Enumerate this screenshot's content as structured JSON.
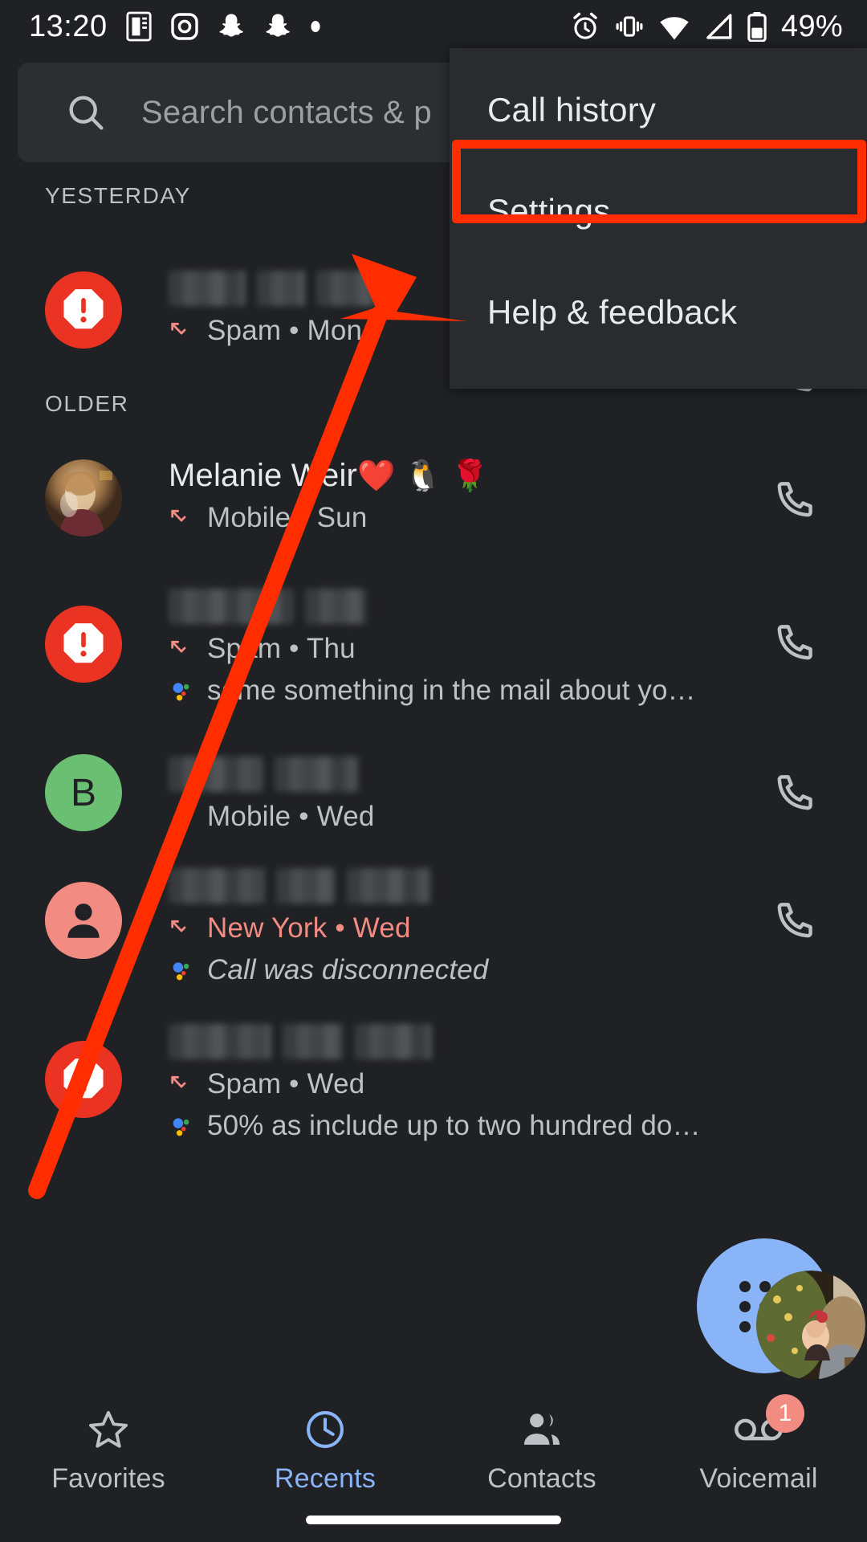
{
  "statusbar": {
    "clock": "13:20",
    "left_icons": [
      "news-icon",
      "instagram-icon",
      "snapchat-icon",
      "snapchat-icon",
      "dot-icon"
    ],
    "right_icons": [
      "alarm-icon",
      "vibrate-icon",
      "wifi-icon",
      "cell-signal-icon",
      "battery-icon"
    ],
    "battery_percent": "49%"
  },
  "search": {
    "placeholder": "Search contacts & p",
    "icon": "search-icon"
  },
  "menu": {
    "items": [
      {
        "label": "Call history",
        "name": "menu-item-call-history",
        "highlighted": false
      },
      {
        "label": "Settings",
        "name": "menu-item-settings",
        "highlighted": true
      },
      {
        "label": "Help & feedback",
        "name": "menu-item-help-feedback",
        "highlighted": false
      }
    ]
  },
  "sections": [
    {
      "header": "YESTERDAY"
    },
    {
      "header": "OLDER"
    }
  ],
  "calls": [
    {
      "avatar_kind": "spam",
      "avatar_label": "",
      "name": "",
      "redacted": true,
      "call_type_icon": "missed-call-icon",
      "subtitle": "Spam • Mon",
      "missed": true,
      "assistant_text": "",
      "has_call_button": false
    },
    {
      "avatar_kind": "photo",
      "avatar_label": "",
      "name": "Melanie Weir",
      "emojis": "❤️ 🐧 🌹",
      "redacted": false,
      "call_type_icon": "missed-call-icon",
      "subtitle": "Mobile • Sun",
      "missed": false,
      "assistant_text": "",
      "has_call_button": true
    },
    {
      "avatar_kind": "spam",
      "avatar_label": "",
      "name": "",
      "redacted": true,
      "call_type_icon": "missed-call-icon",
      "subtitle": "Spam • Thu",
      "missed": false,
      "assistant_text": "same something in the mail about yo…",
      "assistant_italic": false,
      "has_call_button": true
    },
    {
      "avatar_kind": "letter-green",
      "avatar_label": "B",
      "name": "",
      "redacted": true,
      "call_type_icon": "incoming-call-icon",
      "subtitle": "Mobile • Wed",
      "missed": false,
      "assistant_text": "",
      "has_call_button": true
    },
    {
      "avatar_kind": "person-salmon",
      "avatar_label": "",
      "name": "",
      "redacted": true,
      "call_type_icon": "missed-call-icon",
      "subtitle": "New York • Wed",
      "missed": true,
      "assistant_text": "Call was disconnected",
      "assistant_italic": true,
      "has_call_button": true
    },
    {
      "avatar_kind": "spam",
      "avatar_label": "",
      "name": "",
      "redacted": true,
      "call_type_icon": "missed-call-icon",
      "subtitle": "Spam • Wed",
      "missed": false,
      "assistant_text": "50% as include up to two hundred do…",
      "assistant_italic": false,
      "has_call_button": false
    }
  ],
  "fab": {
    "icon": "dialpad-icon"
  },
  "bottomnav": {
    "items": [
      {
        "label": "Favorites",
        "icon": "star-icon",
        "active": false
      },
      {
        "label": "Recents",
        "icon": "clock-icon",
        "active": true
      },
      {
        "label": "Contacts",
        "icon": "people-icon",
        "active": false
      },
      {
        "label": "Voicemail",
        "icon": "voicemail-icon",
        "active": false
      }
    ],
    "voicemail_badge": "1"
  },
  "annotation": {
    "highlight_color": "#ff2d00",
    "arrow_color": "#ff2d00",
    "target": "Settings"
  }
}
